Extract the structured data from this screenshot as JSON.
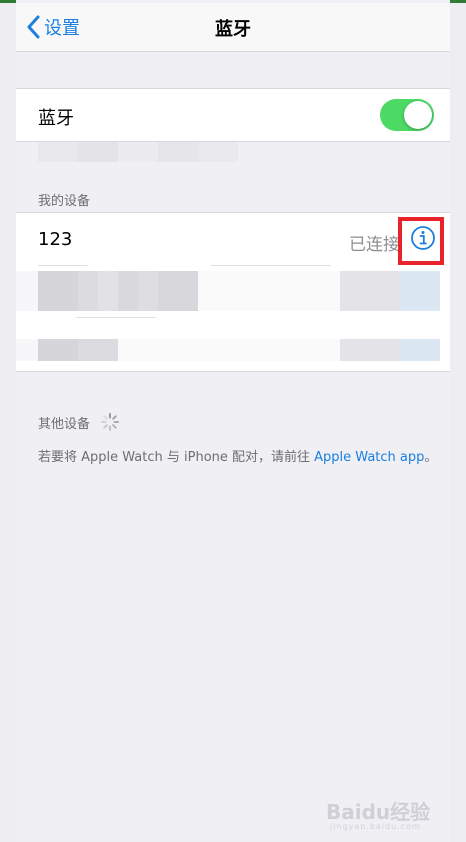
{
  "nav": {
    "back_label": "设置",
    "title": "蓝牙"
  },
  "bluetooth": {
    "label": "蓝牙",
    "enabled": true,
    "toggle_color": "#4cd964"
  },
  "my_devices": {
    "header": "我的设备",
    "devices": [
      {
        "name": "123",
        "status": "已连接"
      }
    ]
  },
  "other_devices": {
    "header": "其他设备",
    "footnote_prefix": "若要将 Apple Watch 与 iPhone 配对，请前往 ",
    "footnote_link": "Apple Watch app",
    "footnote_suffix": "。"
  },
  "colors": {
    "accent": "#1a7fe0",
    "highlight": "#e8232a"
  },
  "watermark": {
    "text": "Baidu经验",
    "sub": "jingyan.baidu.com"
  }
}
